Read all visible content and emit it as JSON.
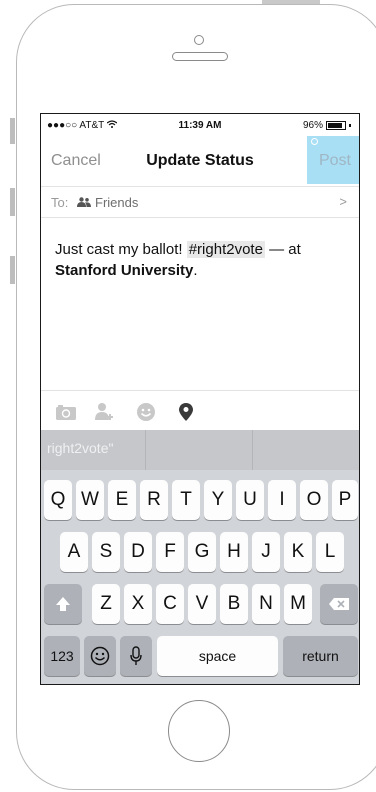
{
  "status_bar": {
    "carrier": "●●●○○ AT&T",
    "time": "11:39 AM",
    "battery": "96%"
  },
  "nav": {
    "cancel": "Cancel",
    "title": "Update Status",
    "post": "Post"
  },
  "audience": {
    "to_label": "To:",
    "value": "Friends",
    "chevron": ">"
  },
  "compose": {
    "text_before": "Just cast my ballot! ",
    "hashtag": "#right2vote",
    "text_after": " — at ",
    "location": "Stanford University",
    "end": "."
  },
  "toolbar": {
    "icons": [
      "camera-icon",
      "tag-friend-icon",
      "emoji-icon",
      "location-pin-icon"
    ]
  },
  "suggestions": [
    "right2vote\"",
    "",
    ""
  ],
  "keyboard": {
    "row1": [
      "Q",
      "W",
      "E",
      "R",
      "T",
      "Y",
      "U",
      "I",
      "O",
      "P"
    ],
    "row2": [
      "A",
      "S",
      "D",
      "F",
      "G",
      "H",
      "J",
      "K",
      "L"
    ],
    "row3": [
      "Z",
      "X",
      "C",
      "V",
      "B",
      "N",
      "M"
    ],
    "numbers": "123",
    "space": "space",
    "return": "return"
  },
  "colors": {
    "post_highlight": "#a9dff5",
    "keyboard_bg": "#d1d4d8",
    "suggestion_bg": "#c5c7ca"
  }
}
